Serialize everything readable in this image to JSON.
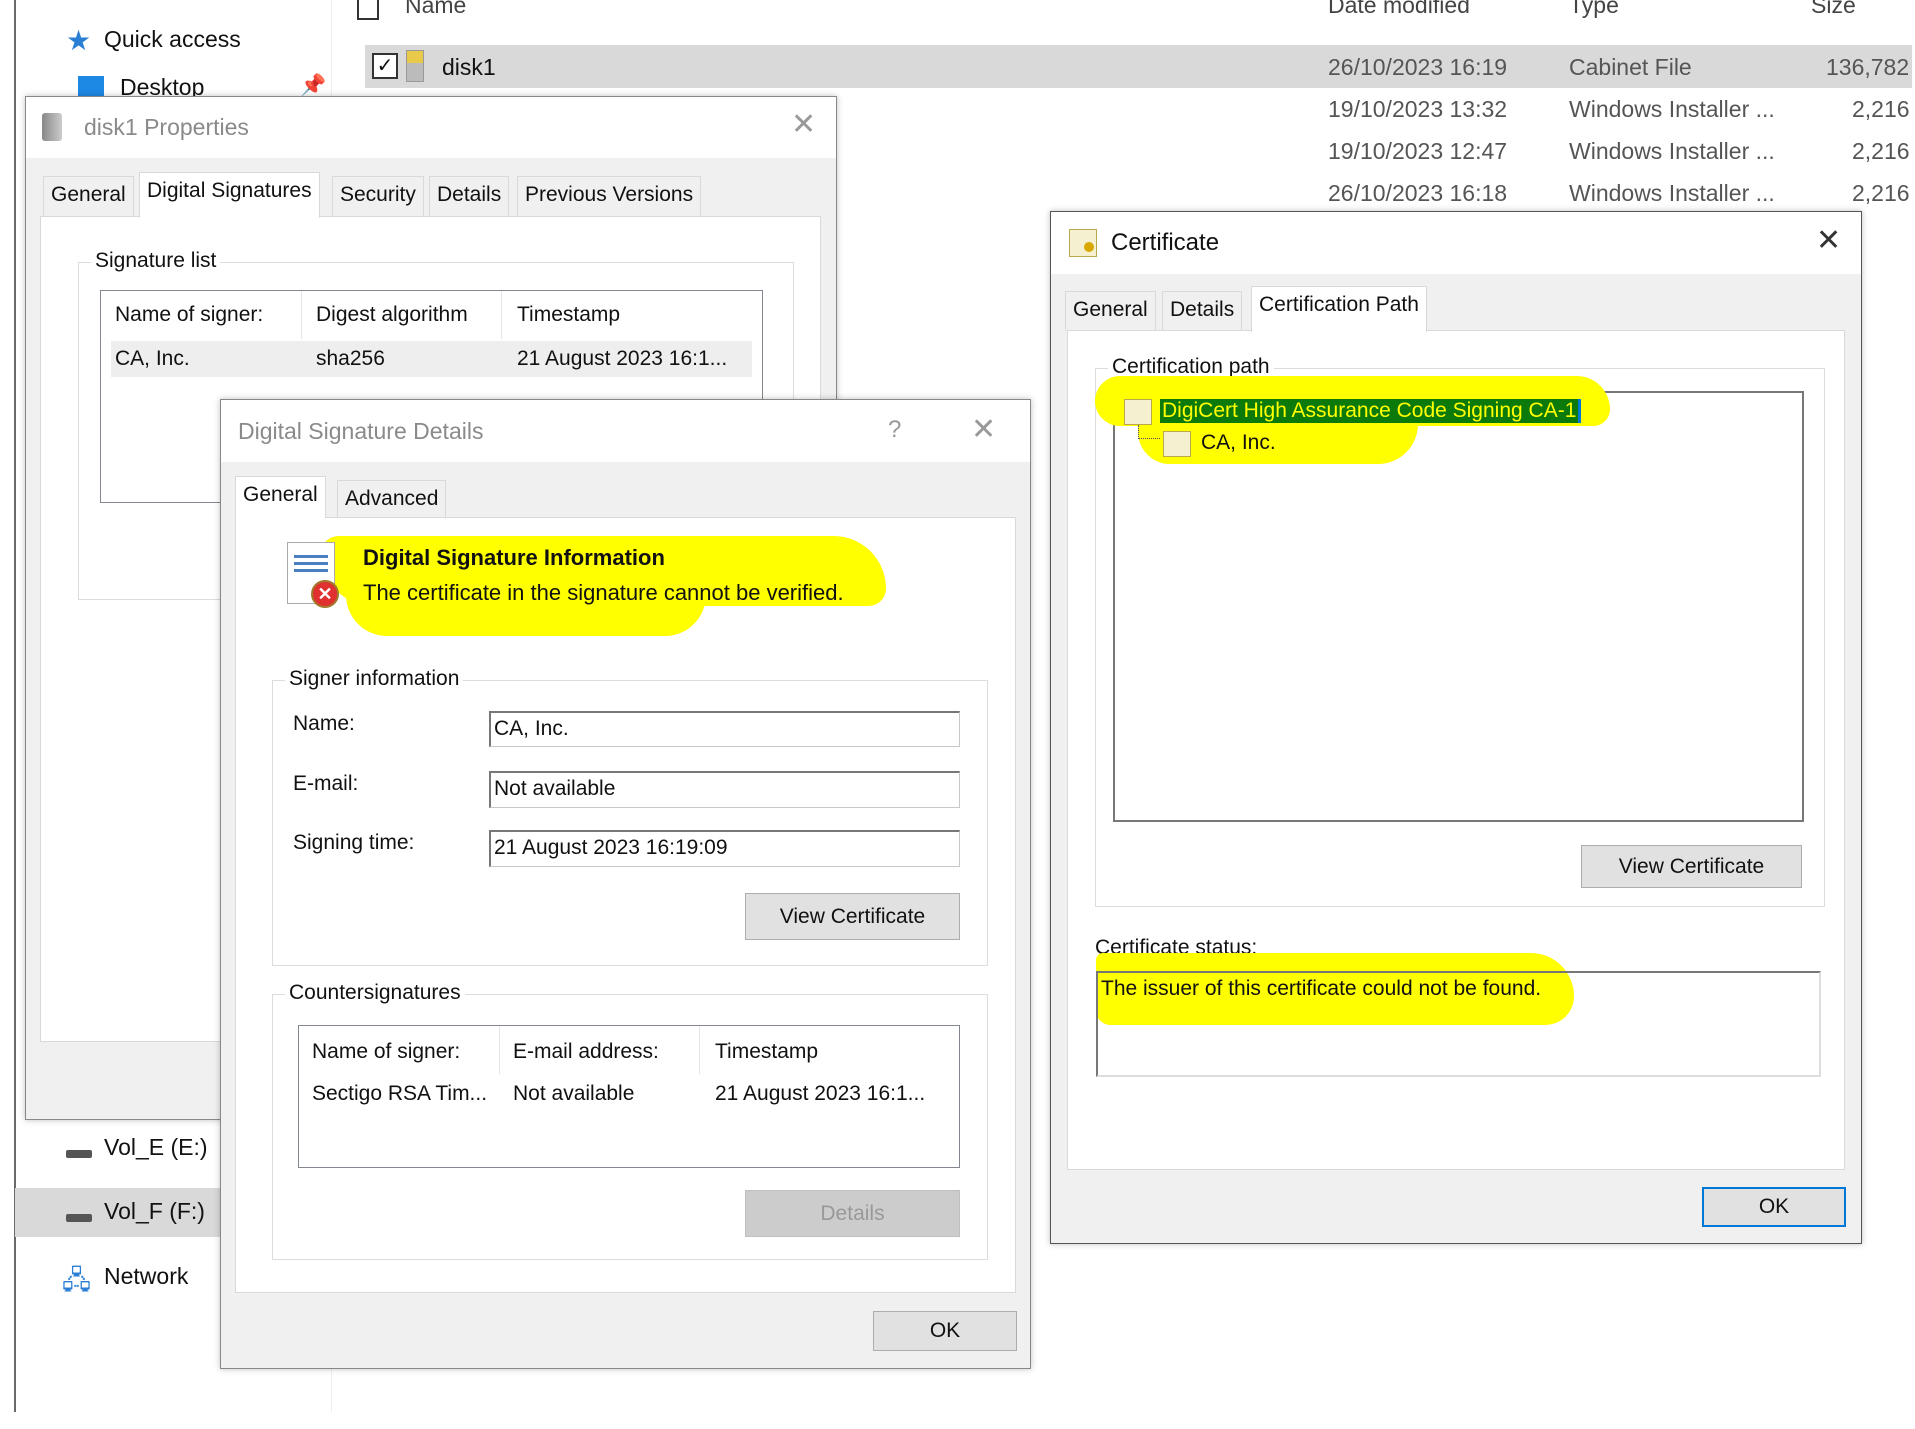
{
  "explorer": {
    "sidebar": {
      "quick_access": "Quick access",
      "desktop": "Desktop",
      "vol_e": "Vol_E (E:)",
      "vol_f": "Vol_F (F:)",
      "network": "Network"
    },
    "columns": {
      "name": "Name",
      "date": "Date modified",
      "type": "Type",
      "size": "Size"
    },
    "files": [
      {
        "name": "disk1",
        "date": "26/10/2023 16:19",
        "type": "Cabinet File",
        "size": "136,782",
        "selected": true
      },
      {
        "name": "",
        "date": "19/10/2023 13:32",
        "type": "Windows Installer ...",
        "size": "2,216"
      },
      {
        "name": "",
        "date": "19/10/2023 12:47",
        "type": "Windows Installer ...",
        "size": "2,216"
      },
      {
        "name": "",
        "date": "26/10/2023 16:18",
        "type": "Windows Installer ...",
        "size": "2,216"
      }
    ]
  },
  "properties": {
    "title": "disk1 Properties",
    "tabs": [
      "General",
      "Digital Signatures",
      "Security",
      "Details",
      "Previous Versions"
    ],
    "group": "Signature list",
    "headers": [
      "Name of signer:",
      "Digest algorithm",
      "Timestamp"
    ],
    "row": [
      "CA, Inc.",
      "sha256",
      "21 August 2023 16:1..."
    ]
  },
  "details": {
    "title": "Digital Signature Details",
    "help": "?",
    "tabs": [
      "General",
      "Advanced"
    ],
    "info_title": "Digital Signature Information",
    "info_msg": "The certificate in the signature cannot be verified.",
    "signer_group": "Signer information",
    "name_label": "Name:",
    "name_value": "CA, Inc.",
    "email_label": "E-mail:",
    "email_value": "Not available",
    "time_label": "Signing time:",
    "time_value": "21 August 2023 16:19:09",
    "view_cert": "View Certificate",
    "counter_group": "Countersignatures",
    "counter_headers": [
      "Name of signer:",
      "E-mail address:",
      "Timestamp"
    ],
    "counter_row": [
      "Sectigo RSA Tim...",
      "Not available",
      "21 August 2023 16:1..."
    ],
    "details_btn": "Details",
    "ok": "OK"
  },
  "certificate": {
    "title": "Certificate",
    "tabs": [
      "General",
      "Details",
      "Certification Path"
    ],
    "path_group": "Certification path",
    "path": [
      "DigiCert High Assurance Code Signing CA-1",
      "CA, Inc."
    ],
    "view_cert": "View Certificate",
    "status_label": "Certificate status:",
    "status": "The issuer of this certificate could not be found.",
    "ok": "OK"
  },
  "colors": {
    "highlight": "#ffff00",
    "selection": "#0b7a0b",
    "accent": "#0078d7"
  }
}
